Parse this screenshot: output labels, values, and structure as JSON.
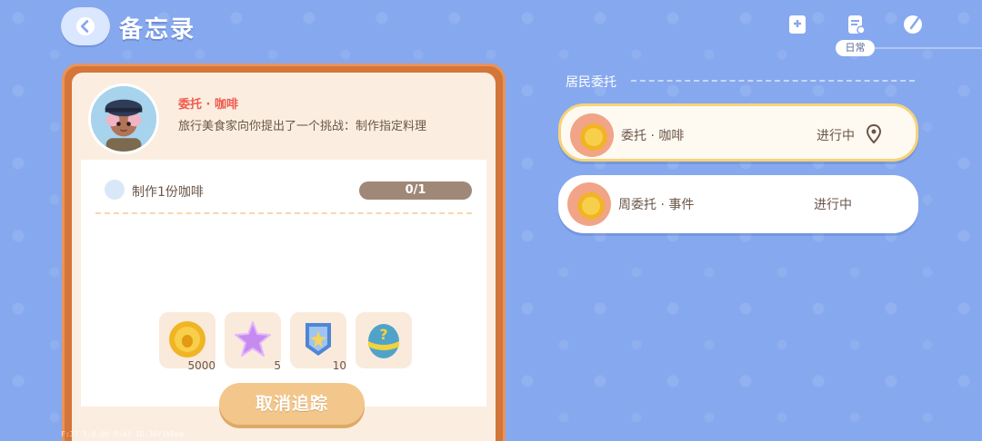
{
  "header": {
    "title": "备忘录",
    "active_tab_label": "日常"
  },
  "quest_card": {
    "name": "委托 · 咖啡",
    "description": "旅行美食家向你提出了一个挑战：制作指定料理",
    "task": {
      "label": "制作1份咖啡",
      "progress_text": "0/1",
      "progress_fraction": 0
    },
    "rewards": [
      {
        "icon": "gold-coin-icon",
        "count": "5000"
      },
      {
        "icon": "purple-star-icon",
        "count": "5"
      },
      {
        "icon": "blue-medal-icon",
        "count": "10"
      },
      {
        "icon": "mystery-egg-icon",
        "count": ""
      }
    ],
    "cancel_label": "取消追踪"
  },
  "quest_list": {
    "section_title": "居民委托",
    "items": [
      {
        "name": "委托 · 咖啡",
        "status": "进行中",
        "tracked": true
      },
      {
        "name": "周委托 · 事件",
        "status": "进行中",
        "tracked": false
      }
    ]
  },
  "debug_text": "F:37  T:0.00  R:43  ID:38r1kBpm",
  "colors": {
    "background": "#86a8ee",
    "card_border": "#d4763a",
    "quest_name_red": "#ef5a4f",
    "button": "#f3c78b",
    "active_outline": "#f6d37a"
  }
}
